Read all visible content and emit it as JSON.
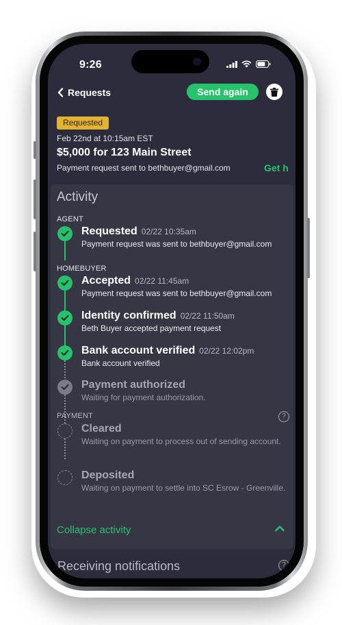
{
  "status_bar": {
    "time": "9:26"
  },
  "header": {
    "back_label": "Requests",
    "send_again_label": "Send again"
  },
  "request": {
    "badge": "Requested",
    "date": "Feb 22nd at 10:15am EST",
    "title": "$5,000 for 123 Main Street",
    "subtitle": "Payment request sent to bethbuyer@gmail.com",
    "link_label": "Get h"
  },
  "activity": {
    "title": "Activity",
    "groups": {
      "agent": "AGENT",
      "homebuyer": "HOMEBUYER",
      "payment": "PAYMENT"
    },
    "steps": [
      {
        "title": "Requested",
        "time": "02/22 10:35am",
        "desc": "Payment request was sent to bethbuyer@gmail.com",
        "state": "done"
      },
      {
        "title": "Accepted",
        "time": "02/22 11:45am",
        "desc": "Payment request was sent to bethbuyer@gmail.com",
        "state": "done"
      },
      {
        "title": "Identity confirmed",
        "time": "02/22 11:50am",
        "desc": "Beth Buyer accepted payment request",
        "state": "done"
      },
      {
        "title": "Bank account verified",
        "time": "02/22 12:02pm",
        "desc": "Bank account verified",
        "state": "done"
      },
      {
        "title": "Payment authorized",
        "time": "",
        "desc": "Waiting for payment authorization.",
        "state": "in-progress"
      },
      {
        "title": "Cleared",
        "time": "",
        "desc": "Waiting on payment to process out of sending account.",
        "state": "pending"
      },
      {
        "title": "Deposited",
        "time": "",
        "desc": "Waiting on payment to settle into SC Esrow - Greenville.",
        "state": "pending"
      }
    ],
    "collapse_label": "Collapse activity"
  },
  "notifications": {
    "title": "Receiving notifications"
  },
  "colors": {
    "accent": "#27c26c",
    "badge": "#e1b32f",
    "background": "#2c2c3c",
    "card": "#363645"
  },
  "icons": [
    "chevron-left-icon",
    "trash-icon",
    "check-icon",
    "help-icon",
    "chevron-up-icon",
    "signal-icon",
    "wifi-icon",
    "battery-icon"
  ]
}
